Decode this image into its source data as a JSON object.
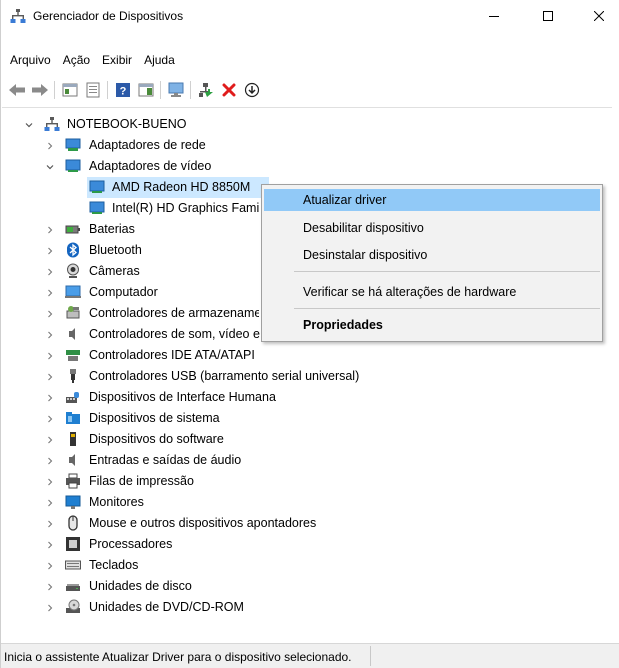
{
  "window": {
    "title": "Gerenciador de Dispositivos",
    "minimize": "—",
    "maximize": "☐",
    "close": "✕"
  },
  "menu": [
    "Arquivo",
    "Ação",
    "Exibir",
    "Ajuda"
  ],
  "toolbar": [
    "back-icon",
    "forward-icon",
    "properties-icon",
    "details-icon",
    "help-icon",
    "action-pane-icon",
    "scan-monitor-icon",
    "update-driver-icon",
    "uninstall-icon",
    "download-icon"
  ],
  "tree": {
    "root": "NOTEBOOK-BUENO",
    "items": [
      {
        "label": "Adaptadores de rede",
        "expanded": false
      },
      {
        "label": "Adaptadores de vídeo",
        "expanded": true
      },
      {
        "label": "AMD Radeon HD 8850M",
        "child": true,
        "selected": true
      },
      {
        "label": "Intel(R) HD Graphics Family",
        "child": true
      },
      {
        "label": "Baterias"
      },
      {
        "label": "Bluetooth"
      },
      {
        "label": "Câmeras"
      },
      {
        "label": "Computador"
      },
      {
        "label": "Controladores de armazenamento"
      },
      {
        "label": "Controladores de som, vídeo e jogos"
      },
      {
        "label": "Controladores IDE ATA/ATAPI"
      },
      {
        "label": "Controladores USB (barramento serial universal)"
      },
      {
        "label": "Dispositivos de Interface Humana"
      },
      {
        "label": "Dispositivos de sistema"
      },
      {
        "label": "Dispositivos do software"
      },
      {
        "label": "Entradas e saídas de áudio"
      },
      {
        "label": "Filas de impressão"
      },
      {
        "label": "Monitores"
      },
      {
        "label": "Mouse e outros dispositivos apontadores"
      },
      {
        "label": "Processadores"
      },
      {
        "label": "Teclados"
      },
      {
        "label": "Unidades de disco"
      },
      {
        "label": "Unidades de DVD/CD-ROM"
      }
    ]
  },
  "context_menu": [
    {
      "label": "Atualizar driver",
      "highlighted": true
    },
    {
      "label": "Desabilitar dispositivo"
    },
    {
      "label": "Desinstalar dispositivo"
    },
    {
      "label": "Verificar se há alterações de hardware"
    },
    {
      "label": "Propriedades",
      "bold": true
    }
  ],
  "status": {
    "text": "Inicia o assistente Atualizar Driver para o dispositivo selecionado."
  },
  "colors": {
    "selection": "#cce8ff",
    "menu_highlight": "#91c9f7",
    "accent": "#0078d7"
  }
}
